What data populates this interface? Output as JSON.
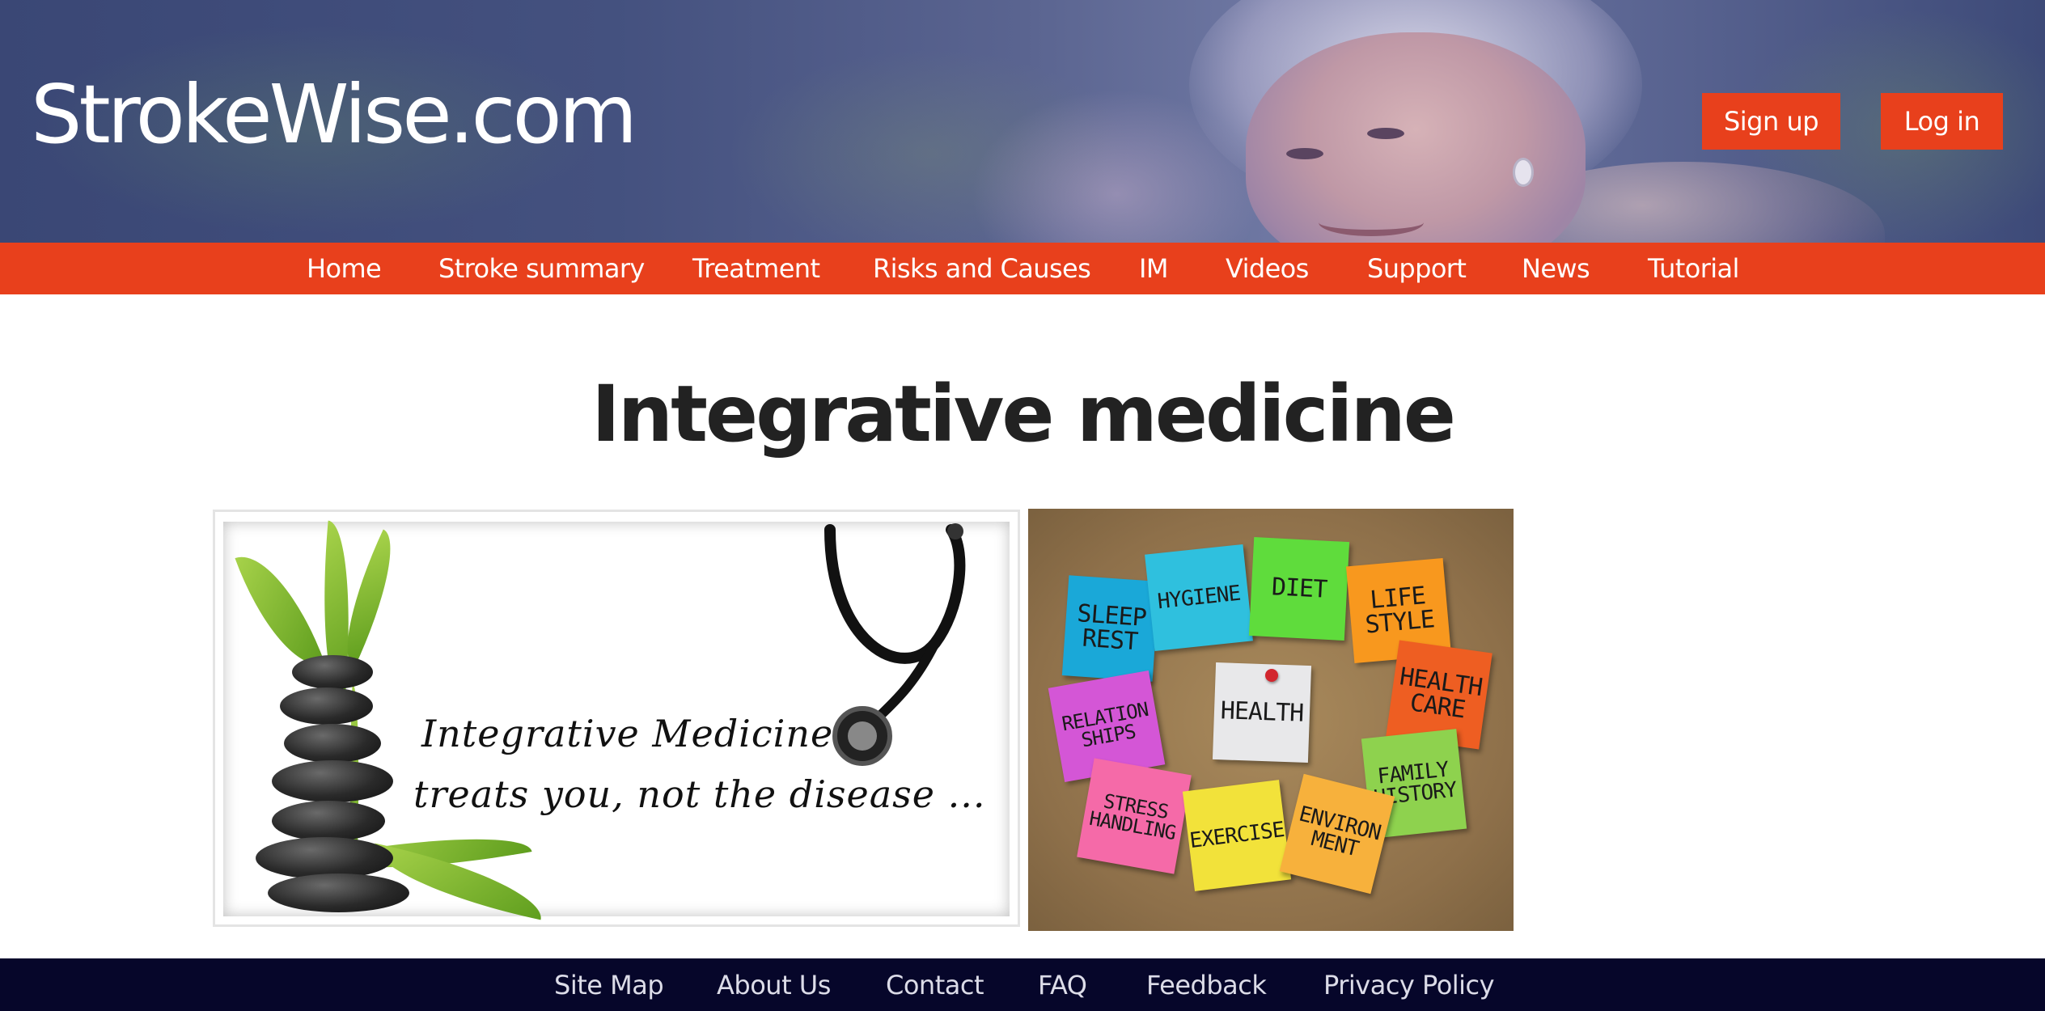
{
  "header": {
    "logo": "StrokeWise.com",
    "signup_label": "Sign up",
    "login_label": "Log in"
  },
  "nav": {
    "items": [
      {
        "label": "Home"
      },
      {
        "label": "Stroke summary"
      },
      {
        "label": "Treatment"
      },
      {
        "label": "Risks and Causes"
      },
      {
        "label": "IM"
      },
      {
        "label": "Videos"
      },
      {
        "label": "Support"
      },
      {
        "label": "News"
      },
      {
        "label": "Tutorial"
      }
    ]
  },
  "main": {
    "title": "Integrative medicine",
    "image_left": {
      "line1": "Integrative Medicine",
      "line2": "treats you, not the disease ..."
    },
    "image_right": {
      "notes": [
        {
          "text": "SLEEP\nREST",
          "color": "#1aa8d8"
        },
        {
          "text": "HYGIENE",
          "color": "#2fc0de"
        },
        {
          "text": "DIET",
          "color": "#5fdc3c"
        },
        {
          "text": "LIFE\nSTYLE",
          "color": "#f8981e"
        },
        {
          "text": "RELATION\nSHIPS",
          "color": "#d456d6"
        },
        {
          "text": "HEALTH",
          "color": "#e8e8ea"
        },
        {
          "text": "HEALTH\nCARE",
          "color": "#ee5e22"
        },
        {
          "text": "FAMILY\nHISTORY",
          "color": "#8ed24e"
        },
        {
          "text": "STRESS\nHANDLING",
          "color": "#f56aa8"
        },
        {
          "text": "EXERCISE",
          "color": "#f2e23a"
        },
        {
          "text": "ENVIRON\nMENT",
          "color": "#f7b13c"
        }
      ]
    }
  },
  "footer": {
    "items": [
      {
        "label": "Site Map"
      },
      {
        "label": "About Us"
      },
      {
        "label": "Contact"
      },
      {
        "label": "FAQ"
      },
      {
        "label": "Feedback"
      },
      {
        "label": "Privacy Policy"
      }
    ]
  },
  "colors": {
    "accent": "#e8401c",
    "footer_bg": "#06062a",
    "title_text": "#222222"
  }
}
